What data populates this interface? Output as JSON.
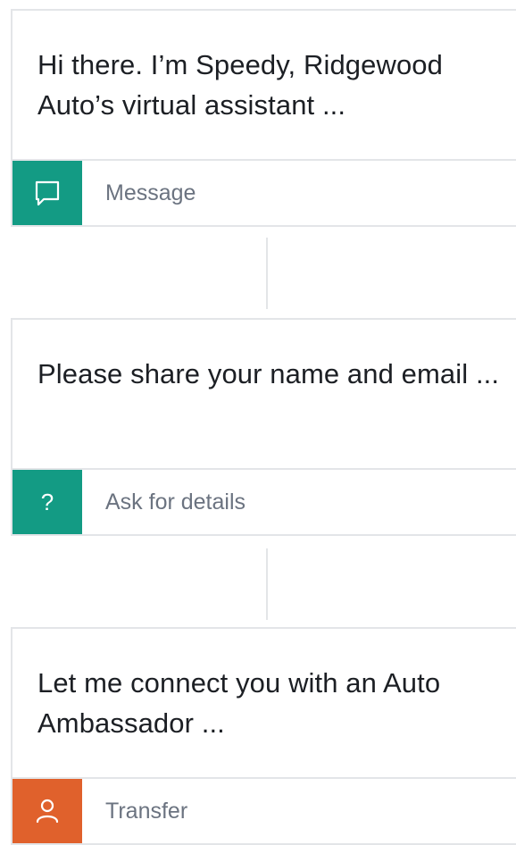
{
  "steps": [
    {
      "text": "Hi there. I’m Speedy, Ridgewood Auto’s virtual assistant ...",
      "label": "Message",
      "icon": "message-icon",
      "color": "#139b84"
    },
    {
      "text": "Please share your name and email ...",
      "label": "Ask for details",
      "icon": "question-icon",
      "icon_glyph": "?",
      "color": "#139b84"
    },
    {
      "text": "Let me connect you with an Auto Ambassador ...",
      "label": "Transfer",
      "icon": "person-icon",
      "color": "#e0612c"
    }
  ]
}
